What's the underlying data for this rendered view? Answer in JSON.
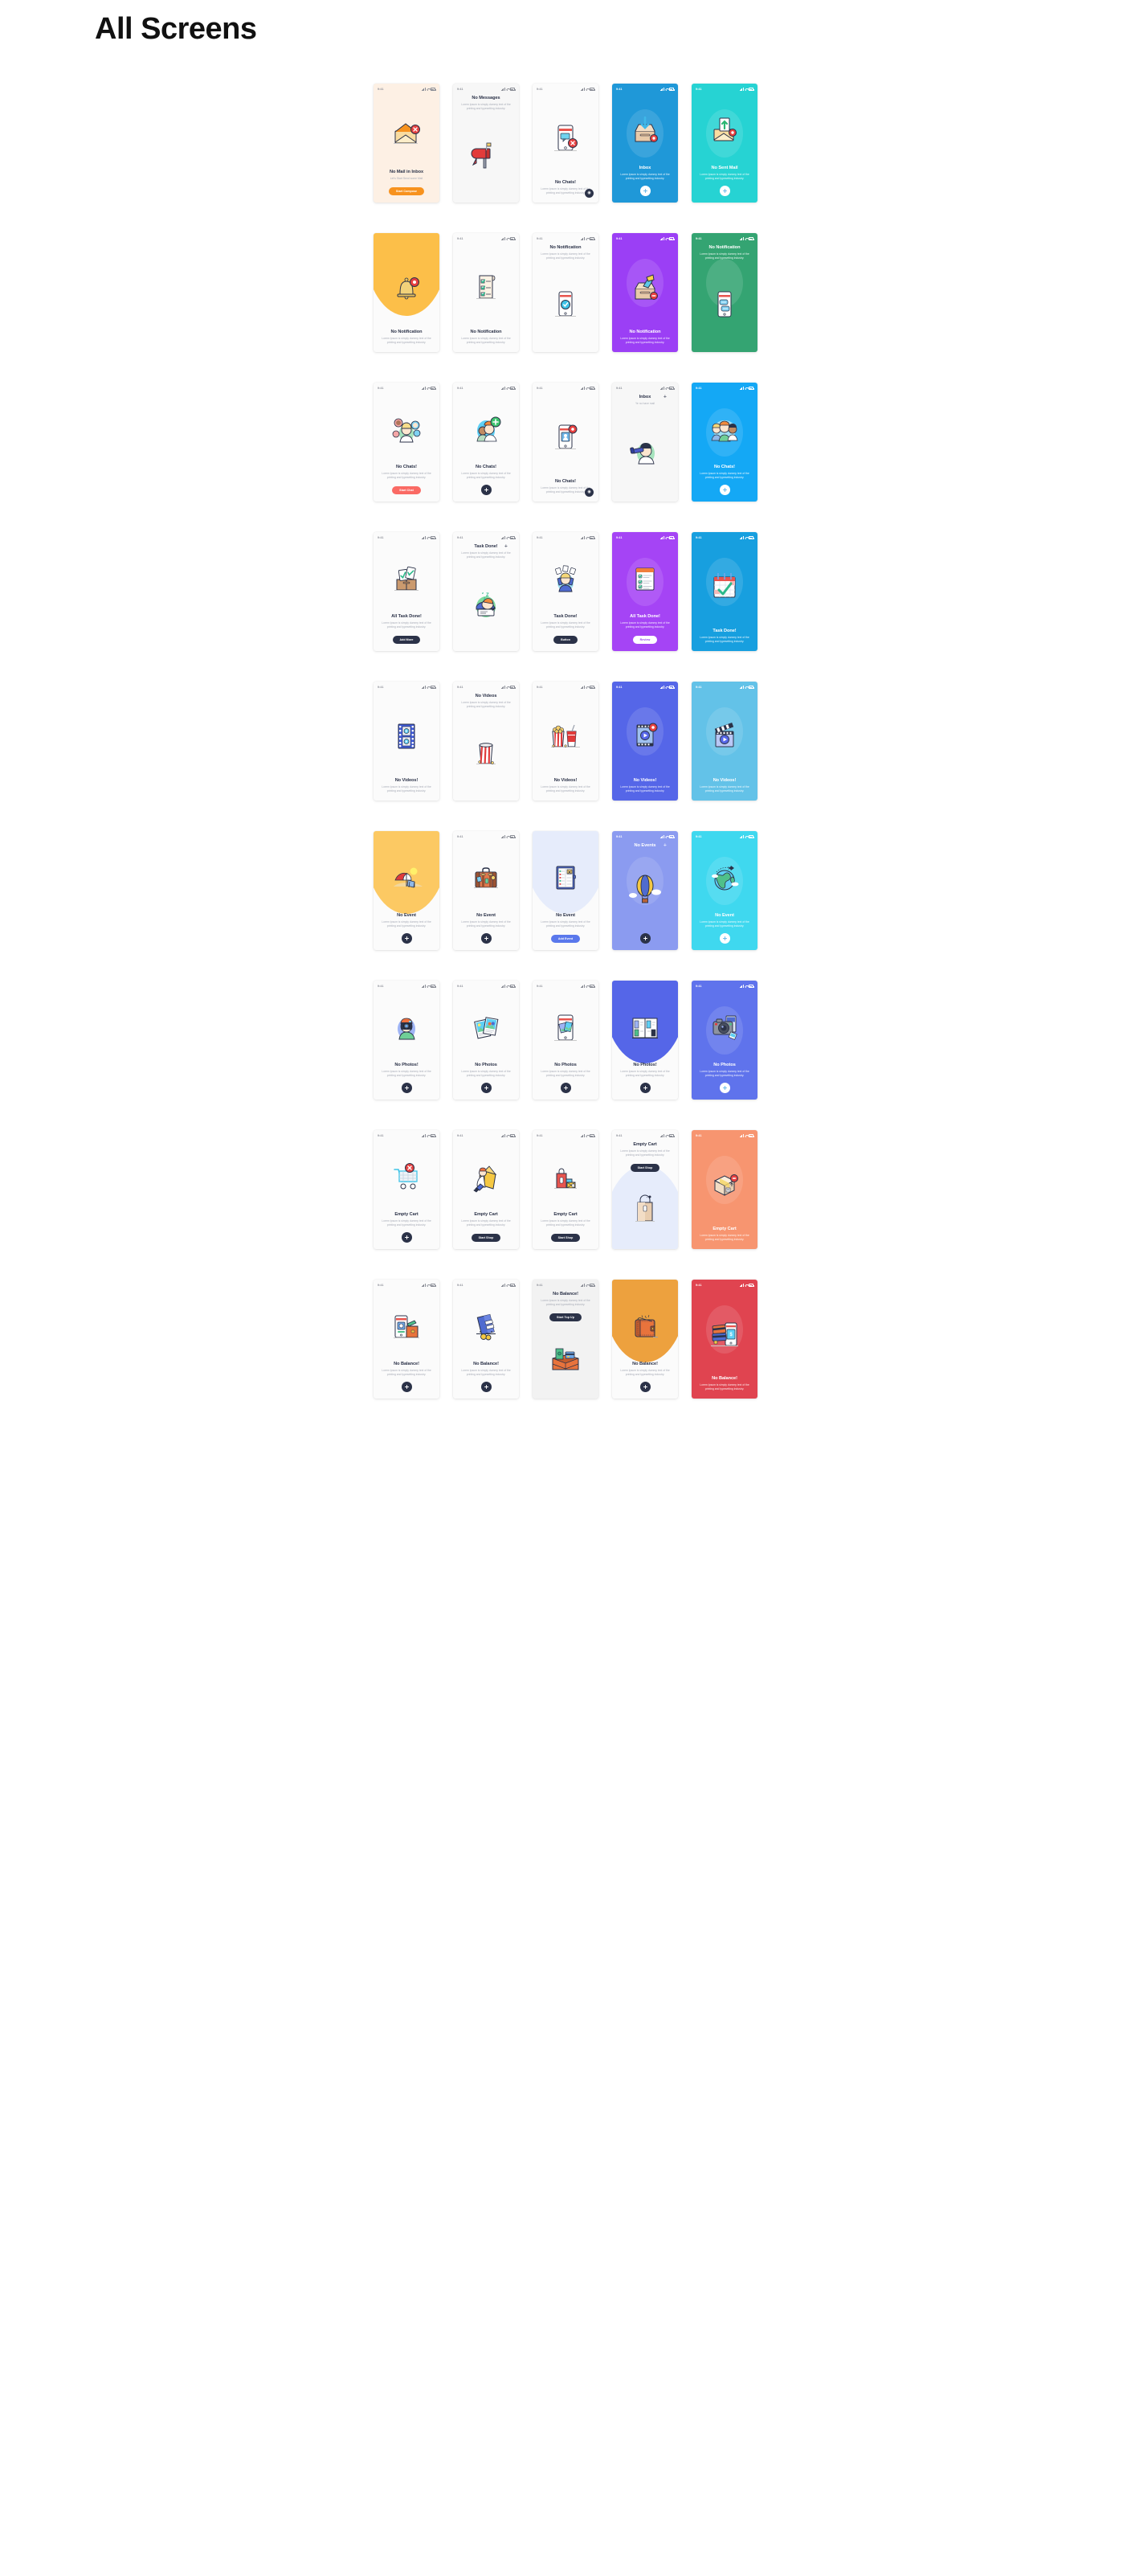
{
  "header": {
    "title": "All Screens"
  },
  "common": {
    "clock": "9:41",
    "lorem": "Lorem Ipsum is simply dummy text of the printing and typesetting industry.",
    "icons": {
      "signal": "signal-icon",
      "wifi": "wifi-icon",
      "battery": "battery-icon",
      "plus": "plus-icon",
      "fab": "fab-add-icon"
    }
  },
  "rows": [
    {
      "name": "mail-row",
      "screens": [
        {
          "id": "no-mail-in-inbox",
          "title": "No Mail in Inbox",
          "subtitle": "Let's Start Send some Mail",
          "button": "Start Compose",
          "button_style": "orange",
          "bg": "#fdf0e4",
          "theme": "light",
          "layout": "bottom",
          "art": "envelope-x"
        },
        {
          "id": "no-messages",
          "title": "No Messages",
          "subtitle": "Lorem Ipsum is simply dummy text of the printing and typesetting industry.",
          "button": "",
          "button_style": "",
          "bg": "#f7f7f7",
          "theme": "light",
          "layout": "top",
          "art": "mailbox"
        },
        {
          "id": "no-chats-phone",
          "title": "No Chats!",
          "subtitle": "Lorem Ipsum is simply dummy text of the printing and typesetting industry.",
          "button": "",
          "button_style": "",
          "bg": "#fbfbfb",
          "theme": "light",
          "layout": "bottom",
          "art": "phone-chat-x",
          "corner_badge": "●"
        },
        {
          "id": "inbox-blue",
          "title": "Inbox",
          "subtitle": "Lorem Ipsum is simply dummy text of the printing and typesetting industry.",
          "button": "fab",
          "button_style": "white",
          "bg": "#1f98d8",
          "theme": "dark",
          "layout": "bottom",
          "art": "inbox-download"
        },
        {
          "id": "no-sent-mail",
          "title": "No Sent Mail",
          "subtitle": "Lorem Ipsum is simply dummy text of the printing and typesetting industry.",
          "button": "fab",
          "button_style": "white",
          "bg": "#26d3d3",
          "theme": "dark",
          "layout": "bottom",
          "art": "envelope-up"
        }
      ]
    },
    {
      "name": "notification-row",
      "screens": [
        {
          "id": "no-notification-bell",
          "title": "No Notification",
          "subtitle": "Lorem Ipsum is simply dummy text of the printing and typesetting industry.",
          "button": "",
          "button_style": "",
          "bg": "#fbfbfb",
          "theme": "light",
          "layout": "bottom",
          "art": "bell",
          "blob": "#fcbf49"
        },
        {
          "id": "no-notification-list",
          "title": "No Notification",
          "subtitle": "Lorem Ipsum is simply dummy text of the printing and typesetting industry.",
          "button": "",
          "button_style": "",
          "bg": "#fbfbfb",
          "theme": "light",
          "layout": "bottom",
          "art": "checklist"
        },
        {
          "id": "no-notification-phone",
          "title": "No Notification",
          "subtitle": "Lorem Ipsum is simply dummy text of the printing and typesetting industry.",
          "button": "",
          "button_style": "",
          "bg": "#fbfbfb",
          "theme": "light",
          "layout": "top",
          "art": "phone-check"
        },
        {
          "id": "no-notification-purple",
          "title": "No Notification",
          "subtitle": "Lorem Ipsum is simply dummy text of the printing and typesetting industry.",
          "button": "",
          "button_style": "",
          "bg": "#9b3ff5",
          "theme": "dark",
          "layout": "bottom",
          "art": "box-papers"
        },
        {
          "id": "no-notification-green",
          "title": "No Notification",
          "subtitle": "Lorem Ipsum is simply dummy text of the printing and typesetting industry.",
          "button": "",
          "button_style": "",
          "bg": "#34a472",
          "theme": "dark",
          "layout": "top",
          "art": "phone-bubbles"
        }
      ]
    },
    {
      "name": "chats-row",
      "screens": [
        {
          "id": "no-chats-avatars",
          "title": "No Chats!",
          "subtitle": "Lorem Ipsum is simply dummy text of the printing and typesetting industry.",
          "button": "Start Chat",
          "button_style": "red",
          "bg": "#fbfbfb",
          "theme": "light",
          "layout": "bottom",
          "art": "avatar-cluster"
        },
        {
          "id": "no-chats-add",
          "title": "No Chats!",
          "subtitle": "Lorem Ipsum is simply dummy text of the printing and typesetting industry.",
          "button": "fab",
          "button_style": "navy",
          "bg": "#fbfbfb",
          "theme": "light",
          "layout": "bottom",
          "art": "two-friends-plus"
        },
        {
          "id": "no-chats-phone2",
          "title": "No Chats!",
          "subtitle": "Lorem Ipsum is simply dummy text of the printing and typesetting industry.",
          "button": "",
          "button_style": "",
          "bg": "#fbfbfb",
          "theme": "light",
          "layout": "bottom",
          "art": "phone-contact-x",
          "corner_badge": "●"
        },
        {
          "id": "inbox-search",
          "title": "Inbox",
          "subtitle": "Ye no have mail",
          "button": "",
          "button_style": "",
          "bg": "#f7f7f7",
          "theme": "light",
          "layout": "topbar",
          "art": "person-telescope"
        },
        {
          "id": "no-chats-blue",
          "title": "No Chats!",
          "subtitle": "Lorem Ipsum is simply dummy text of the printing and typesetting industry.",
          "button": "fab",
          "button_style": "white",
          "bg": "#14a8f5",
          "theme": "dark",
          "layout": "bottom",
          "art": "three-friends"
        }
      ]
    },
    {
      "name": "tasks-row",
      "screens": [
        {
          "id": "all-task-done-box",
          "title": "All Task Done!",
          "subtitle": "Lorem Ipsum is simply dummy text of the printing and typesetting industry.",
          "button": "Add More",
          "button_style": "navy",
          "bg": "#fbfbfb",
          "theme": "light",
          "layout": "bottom",
          "art": "box-tasks"
        },
        {
          "id": "task-done-sleep",
          "title": "Task Done!",
          "subtitle": "Lorem Ipsum is simply dummy text of the printing and typesetting industry.",
          "button": "",
          "button_style": "",
          "bg": "#fbfbfb",
          "theme": "light",
          "layout": "topbar",
          "art": "sleeping-student"
        },
        {
          "id": "task-done-celebrate",
          "title": "Task Done!",
          "subtitle": "Lorem Ipsum is simply dummy text of the printing and typesetting industry.",
          "button": "Button",
          "button_style": "navy",
          "bg": "#fbfbfb",
          "theme": "light",
          "layout": "bottom",
          "art": "celebrating-person"
        },
        {
          "id": "all-task-done-purple",
          "title": "All Task Done!",
          "subtitle": "Lorem Ipsum is simply dummy text of the printing and typesetting industry.",
          "button": "Review",
          "button_style": "white",
          "bg": "#a544f5",
          "theme": "dark",
          "layout": "bottom",
          "art": "checklist-card"
        },
        {
          "id": "task-done-calendar",
          "title": "Task Done!",
          "subtitle": "Lorem Ipsum is simply dummy text of the printing and typesetting industry.",
          "button": "",
          "button_style": "",
          "bg": "#179fdf",
          "theme": "dark",
          "layout": "bottom",
          "art": "calendar-check"
        }
      ]
    },
    {
      "name": "videos-row",
      "screens": [
        {
          "id": "no-videos-film",
          "title": "No Videos!",
          "subtitle": "Lorem Ipsum is simply dummy text of the printing and typesetting industry.",
          "button": "",
          "button_style": "",
          "bg": "#fbfbfb",
          "theme": "light",
          "layout": "bottom",
          "art": "film-strip"
        },
        {
          "id": "no-videos-popcorn-bin",
          "title": "No Videos",
          "subtitle": "Lorem Ipsum is simply dummy text of the printing and typesetting industry.",
          "button": "",
          "button_style": "",
          "bg": "#fbfbfb",
          "theme": "light",
          "layout": "top",
          "art": "empty-popcorn"
        },
        {
          "id": "no-videos-combo",
          "title": "No Videos!",
          "subtitle": "Lorem Ipsum is simply dummy text of the printing and typesetting industry.",
          "button": "",
          "button_style": "",
          "bg": "#fbfbfb",
          "theme": "light",
          "layout": "bottom",
          "art": "popcorn-soda"
        },
        {
          "id": "no-videos-indigo",
          "title": "No Videos!",
          "subtitle": "Lorem Ipsum is simply dummy text of the printing and typesetting industry.",
          "button": "",
          "button_style": "",
          "bg": "#5566e8",
          "theme": "dark",
          "layout": "bottom",
          "art": "play-card"
        },
        {
          "id": "no-videos-cyan",
          "title": "No Videos!",
          "subtitle": "Lorem Ipsum is simply dummy text of the printing and typesetting industry.",
          "button": "",
          "button_style": "",
          "bg": "#63c2e8",
          "theme": "dark",
          "layout": "bottom",
          "art": "clapperboard"
        }
      ]
    },
    {
      "name": "events-row",
      "screens": [
        {
          "id": "no-event-beach",
          "title": "No Event",
          "subtitle": "Lorem Ipsum is simply dummy text of the printing and typesetting industry.",
          "button": "fab",
          "button_style": "navy",
          "bg": "#fbfbfb",
          "theme": "light",
          "layout": "bottom",
          "art": "beach",
          "blob": "#fcc963"
        },
        {
          "id": "no-event-suitcase",
          "title": "No Event",
          "subtitle": "Lorem Ipsum is simply dummy text of the printing and typesetting industry.",
          "button": "fab",
          "button_style": "navy",
          "bg": "#fbfbfb",
          "theme": "light",
          "layout": "bottom",
          "art": "suitcase"
        },
        {
          "id": "no-event-agenda",
          "title": "No Event",
          "subtitle": "Lorem Ipsum is simply dummy text of the printing and typesetting industry.",
          "button": "Add Event",
          "button_style": "blue",
          "bg": "#fbfbfb",
          "theme": "light",
          "layout": "bottom",
          "art": "agenda",
          "blob": "#e6ecfb"
        },
        {
          "id": "no-events-balloon",
          "title": "No Events",
          "subtitle": "",
          "button": "fab",
          "button_style": "navy",
          "bg": "#8b9bf0",
          "theme": "dark",
          "layout": "topbar",
          "art": "hot-air-balloon"
        },
        {
          "id": "no-event-globe",
          "title": "No Event",
          "subtitle": "Lorem Ipsum is simply dummy text of the printing and typesetting industry.",
          "button": "fab",
          "button_style": "white",
          "bg": "#3fd8ef",
          "theme": "dark",
          "layout": "bottom",
          "art": "globe-plane"
        }
      ]
    },
    {
      "name": "photos-row",
      "screens": [
        {
          "id": "no-photos-camera-guy",
          "title": "No Photos!",
          "subtitle": "Lorem Ipsum is simply dummy text of the printing and typesetting industry.",
          "button": "fab",
          "button_style": "navy",
          "bg": "#fbfbfb",
          "theme": "light",
          "layout": "bottom",
          "art": "photographer"
        },
        {
          "id": "no-photos-prints",
          "title": "No Photos",
          "subtitle": "Lorem Ipsum is simply dummy text of the printing and typesetting industry.",
          "button": "fab",
          "button_style": "navy",
          "bg": "#fbfbfb",
          "theme": "light",
          "layout": "bottom",
          "art": "photo-prints"
        },
        {
          "id": "no-photos-phone",
          "title": "No Photos",
          "subtitle": "Lorem Ipsum is simply dummy text of the printing and typesetting industry.",
          "button": "fab",
          "button_style": "navy",
          "bg": "#fbfbfb",
          "theme": "light",
          "layout": "bottom",
          "art": "phone-gallery"
        },
        {
          "id": "no-photos-gallery",
          "title": "No Photos!",
          "subtitle": "Lorem Ipsum is simply dummy text of the printing and typesetting industry.",
          "button": "fab",
          "button_style": "navy",
          "bg": "#fbfbfb",
          "theme": "light",
          "layout": "bottom",
          "art": "gallery-wall",
          "blob": "#5566e8"
        },
        {
          "id": "no-photos-camera",
          "title": "No Photos",
          "subtitle": "Lorem Ipsum is simply dummy text of the printing and typesetting industry.",
          "button": "fab",
          "button_style": "white",
          "bg": "#5f73ec",
          "theme": "dark",
          "layout": "bottom",
          "art": "camera"
        }
      ]
    },
    {
      "name": "cart-row",
      "screens": [
        {
          "id": "empty-cart-trolley",
          "title": "Empty Cart",
          "subtitle": "Lorem Ipsum is simply dummy text of the printing and typesetting industry.",
          "button": "fab",
          "button_style": "navy",
          "bg": "#fbfbfb",
          "theme": "light",
          "layout": "bottom",
          "art": "cart-x"
        },
        {
          "id": "empty-cart-box-person",
          "title": "Empty Cart",
          "subtitle": "Lorem Ipsum is simply dummy text of the printing and typesetting industry.",
          "button": "Start Shop",
          "button_style": "navy",
          "bg": "#fbfbfb",
          "theme": "light",
          "layout": "bottom",
          "art": "person-in-box"
        },
        {
          "id": "empty-cart-bags",
          "title": "Empty Cart",
          "subtitle": "Lorem Ipsum is simply dummy text of the printing and typesetting industry.",
          "button": "Start Shop",
          "button_style": "navy",
          "bg": "#fbfbfb",
          "theme": "light",
          "layout": "bottom",
          "art": "shopping-bags"
        },
        {
          "id": "empty-cart-bag-top",
          "title": "Empty Cart",
          "subtitle": "Lorem Ipsum is simply dummy text of the printing and typesetting industry.",
          "button": "Start Shop",
          "button_style": "navy",
          "bg": "#fbfbfb",
          "theme": "light",
          "layout": "top",
          "art": "empty-bag",
          "blob_bottom": "#e6ecfb"
        },
        {
          "id": "empty-cart-orange",
          "title": "Empty Cart",
          "subtitle": "Lorem Ipsum is simply dummy text of the printing and typesetting industry.",
          "button": "",
          "button_style": "",
          "bg": "#f79570",
          "theme": "dark",
          "layout": "bottom",
          "art": "parcel-box"
        }
      ]
    },
    {
      "name": "balance-row",
      "screens": [
        {
          "id": "no-balance-phone-wallet",
          "title": "No Balance!",
          "subtitle": "Lorem Ipsum is simply dummy text of the printing and typesetting industry.",
          "button": "fab",
          "button_style": "navy",
          "bg": "#fbfbfb",
          "theme": "light",
          "layout": "bottom",
          "art": "phone-wallet"
        },
        {
          "id": "no-balance-wallet-coins",
          "title": "No Balance!",
          "subtitle": "Lorem Ipsum is simply dummy text of the printing and typesetting industry.",
          "button": "fab",
          "button_style": "navy",
          "bg": "#fbfbfb",
          "theme": "light",
          "layout": "bottom",
          "art": "wallet-coins"
        },
        {
          "id": "no-balance-topup",
          "title": "No Balance!",
          "subtitle": "Lorem Ipsum is simply dummy text of the printing and typesetting industry.",
          "button": "Start Top Up",
          "button_style": "navy",
          "bg": "#f2f2f2",
          "theme": "light",
          "layout": "top",
          "art": "open-wallet"
        },
        {
          "id": "no-balance-yellow",
          "title": "No Balance!",
          "subtitle": "Lorem Ipsum is simply dummy text of the printing and typesetting industry.",
          "button": "fab",
          "button_style": "navy",
          "bg": "#fbfbfb",
          "theme": "light",
          "layout": "bottom",
          "art": "wallet-closed",
          "blob": "#eda13e"
        },
        {
          "id": "no-balance-red",
          "title": "No Balance!",
          "subtitle": "Lorem Ipsum is simply dummy text of the printing and typesetting industry.",
          "button": "",
          "button_style": "",
          "bg": "#e04450",
          "theme": "dark",
          "layout": "bottom",
          "art": "cards-phone"
        }
      ]
    }
  ]
}
